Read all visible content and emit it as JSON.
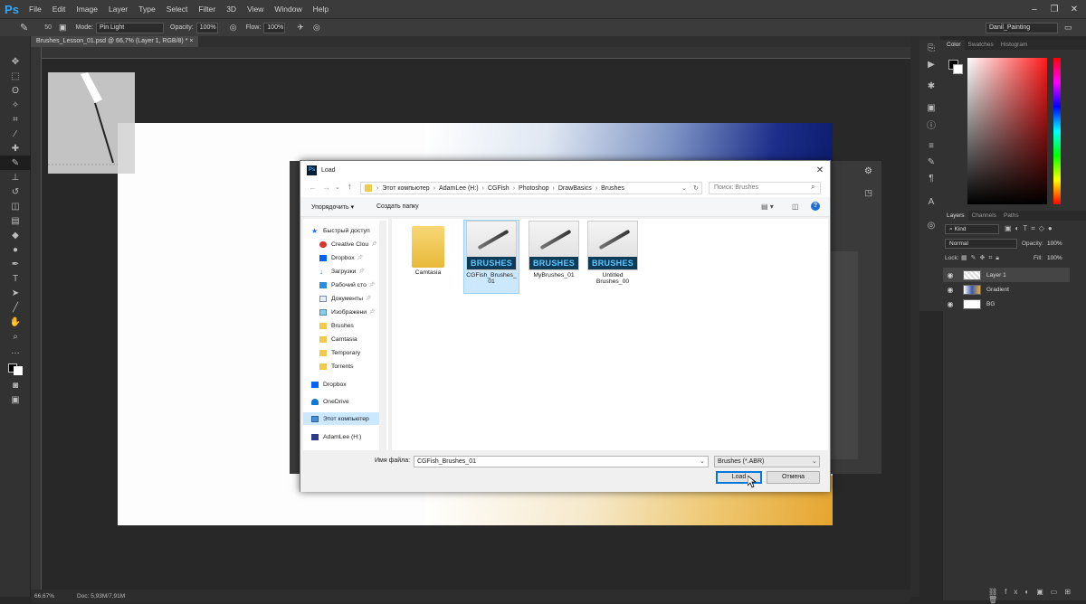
{
  "app": {
    "logo": "Ps",
    "menu": [
      "File",
      "Edit",
      "Image",
      "Layer",
      "Type",
      "Select",
      "Filter",
      "3D",
      "View",
      "Window",
      "Help"
    ],
    "workspace": "Danil_Painting"
  },
  "options": {
    "brush_size": "50",
    "mode_label": "Mode:",
    "mode_value": "Pin Light",
    "opacity_label": "Opacity:",
    "opacity_value": "100%",
    "flow_label": "Flow:",
    "flow_value": "100%"
  },
  "document": {
    "tab_title": "Brushes_Lesson_01.psd @ 66,7% (Layer 1, RGB/8) *"
  },
  "status": {
    "zoom": "66,67%",
    "doc": "Doc: 5,93M/7,91M"
  },
  "panels": {
    "color_tabs": [
      "Color",
      "Swatches",
      "Histogram"
    ],
    "layer_tabs": [
      "Layers",
      "Channels",
      "Paths"
    ],
    "kind_label": "Kind",
    "blend_mode": "Normal",
    "opacity_label": "Opacity:",
    "opacity_value": "100%",
    "lock_label": "Lock:",
    "fill_label": "Fill:",
    "fill_value": "100%",
    "layers": [
      "Layer 1",
      "Gradient",
      "BG"
    ],
    "colors": {
      "accent": "#31a8ff",
      "panel": "#323232",
      "foreground": "#000000",
      "background": "#ffffff"
    }
  },
  "dialog": {
    "title": "Load",
    "breadcrumb": [
      "Этот компьютер",
      "AdamLee (H:)",
      "CGFish",
      "Photoshop",
      "DrawBasics",
      "Brushes"
    ],
    "search_placeholder": "Поиск: Brushes",
    "organize": "Упорядочить ▾",
    "new_folder": "Создать папку",
    "nav": [
      {
        "label": "Быстрый доступ",
        "icon": "star-icon",
        "pinned": false
      },
      {
        "label": "Creative Clou",
        "icon": "creative-cloud-icon",
        "pinned": true
      },
      {
        "label": "Dropbox",
        "icon": "dropbox-icon",
        "pinned": true
      },
      {
        "label": "Загрузки",
        "icon": "download-icon",
        "pinned": true
      },
      {
        "label": "Рабочий сто",
        "icon": "desktop-icon",
        "pinned": true
      },
      {
        "label": "Документы",
        "icon": "documents-icon",
        "pinned": true
      },
      {
        "label": "Изображени",
        "icon": "pictures-icon",
        "pinned": true
      },
      {
        "label": "Brushes",
        "icon": "folder-icon",
        "pinned": false
      },
      {
        "label": "Camtasia",
        "icon": "folder-icon",
        "pinned": false
      },
      {
        "label": "Temporary",
        "icon": "folder-icon",
        "pinned": false
      },
      {
        "label": "Torrents",
        "icon": "folder-icon",
        "pinned": false
      },
      {
        "label": "Dropbox",
        "icon": "dropbox-icon",
        "pinned": false
      },
      {
        "label": "OneDrive",
        "icon": "onedrive-icon",
        "pinned": false
      },
      {
        "label": "Этот компьютер",
        "icon": "computer-icon",
        "pinned": false
      },
      {
        "label": "AdamLee (H:)",
        "icon": "drive-icon",
        "pinned": false
      }
    ],
    "files": [
      {
        "name": "Camtasia",
        "type": "folder"
      },
      {
        "name": "CGFish_Brushes_\n01",
        "type": "brush",
        "selected": true
      },
      {
        "name": "MyBrushes_01",
        "type": "brush"
      },
      {
        "name": "Untitled\nBrushes_00",
        "type": "brush"
      }
    ],
    "brush_badge": "BRUSHES",
    "filename_label": "Имя файла:",
    "filename_value": "CGFish_Brushes_01",
    "filetype": "Brushes (*.ABR)",
    "load_button": "Load",
    "cancel_button": "Отмена"
  }
}
